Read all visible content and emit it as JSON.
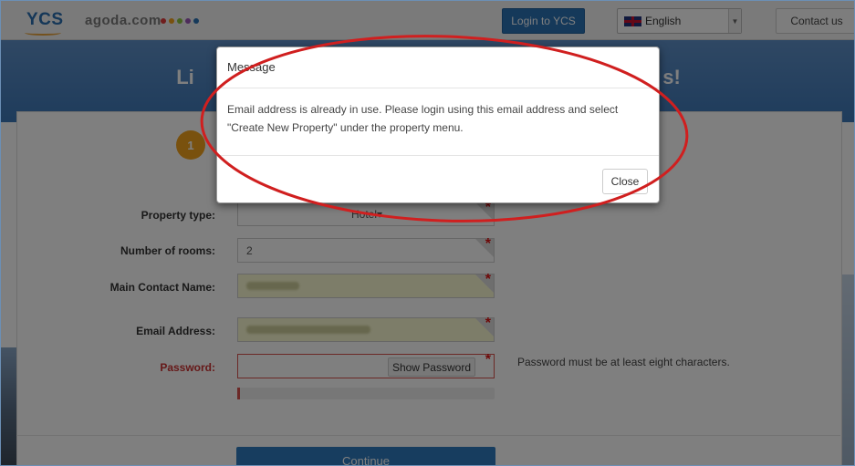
{
  "header": {
    "logo": "YCS",
    "brand": "agoda.com",
    "brand_dot_colors": [
      "#e03a3a",
      "#f2a21c",
      "#8dc63f",
      "#9b59b6",
      "#2a72b5"
    ],
    "login_label": "Login to YCS",
    "language": "English",
    "contact_label": "Contact us"
  },
  "hero": {
    "title": "Li                                                                                    s!"
  },
  "steps": {
    "current": "1"
  },
  "form": {
    "property_type_label": "Property type:",
    "property_type_value": "Hotel",
    "rooms_label": "Number of rooms:",
    "rooms_value": "2",
    "contact_name_label": "Main Contact Name:",
    "email_label": "Email Address:",
    "password_label": "Password:",
    "show_password_label": "Show Password",
    "password_hint": "Password must be at least eight characters.",
    "password_strength": 0.01,
    "continue_label": "Continue"
  },
  "modal": {
    "title": "Message",
    "body": "Email address is already in use. Please login using this email address and select \"Create New Property\" under the property menu.",
    "close_label": "Close"
  },
  "colors": {
    "accent": "#2a72b5",
    "step": "#f2a21c",
    "required": "#dd1111",
    "annotation": "#d01f1f"
  }
}
